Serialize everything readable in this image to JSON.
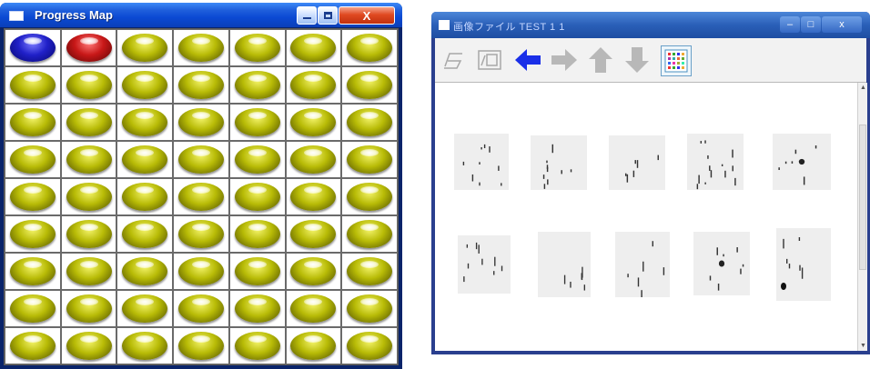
{
  "left_window": {
    "title": "Progress Map",
    "grid": {
      "rows": 9,
      "cols": 7
    },
    "states": [
      "blue",
      "red"
    ],
    "default_state": "yellow",
    "colors": {
      "blue": "#1818a8",
      "red": "#a81010",
      "yellow": "#b5b800"
    }
  },
  "right_window": {
    "title": "画像ファイル TEST 1 1",
    "toolbar": {
      "buttons": [
        {
          "name": "tool1-icon"
        },
        {
          "name": "tool2-icon"
        },
        {
          "name": "back-arrow-icon",
          "color": "#1a2fe8"
        },
        {
          "name": "forward-arrow-icon",
          "color": "#b8b8b8"
        },
        {
          "name": "up-arrow-icon",
          "color": "#b8b8b8"
        },
        {
          "name": "down-arrow-icon",
          "color": "#b8b8b8"
        },
        {
          "name": "grid-view-icon"
        }
      ]
    },
    "thumbnails_count": 10
  }
}
